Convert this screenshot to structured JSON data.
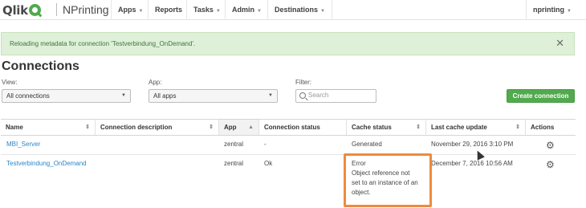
{
  "brand": {
    "logo_text": "Qlik",
    "product": "NPrinting",
    "accent_color": "#52a94e"
  },
  "nav": {
    "items": [
      {
        "label": "Apps",
        "has_dropdown": true
      },
      {
        "label": "Reports",
        "has_dropdown": false
      },
      {
        "label": "Tasks",
        "has_dropdown": true
      },
      {
        "label": "Admin",
        "has_dropdown": true
      },
      {
        "label": "Destinations",
        "has_dropdown": true
      }
    ],
    "user": "nprinting"
  },
  "notification": {
    "text": "Reloading metadata for connection 'Testverbindung_OnDemand'.",
    "close_icon": "close-icon"
  },
  "page_title": "Connections",
  "filters": {
    "view_label": "View:",
    "view_value": "All connections",
    "app_label": "App:",
    "app_value": "All apps",
    "filter_label": "Filter:",
    "search_placeholder": "Search"
  },
  "create_button": "Create connection",
  "table": {
    "headers": [
      "Name",
      "Connection description",
      "App",
      "Connection status",
      "Cache status",
      "Last cache update",
      "Actions"
    ],
    "rows": [
      {
        "name": "MBI_Server",
        "description": "",
        "app": "zentral",
        "status": "-",
        "cache_status": "Generated",
        "last_update": "November 29, 2016 3:10 PM",
        "action_icon": "gear-icon"
      },
      {
        "name": "Testverbindung_OnDemand",
        "description": "",
        "app": "zentral",
        "status": "Ok",
        "cache_status_lines": [
          "Error",
          "Object reference not",
          "set to an instance of an",
          "object."
        ],
        "last_update": "December 7, 2016 10:56 AM",
        "action_icon": "gear-icon"
      }
    ]
  },
  "highlight_color": "#ef8a3d"
}
